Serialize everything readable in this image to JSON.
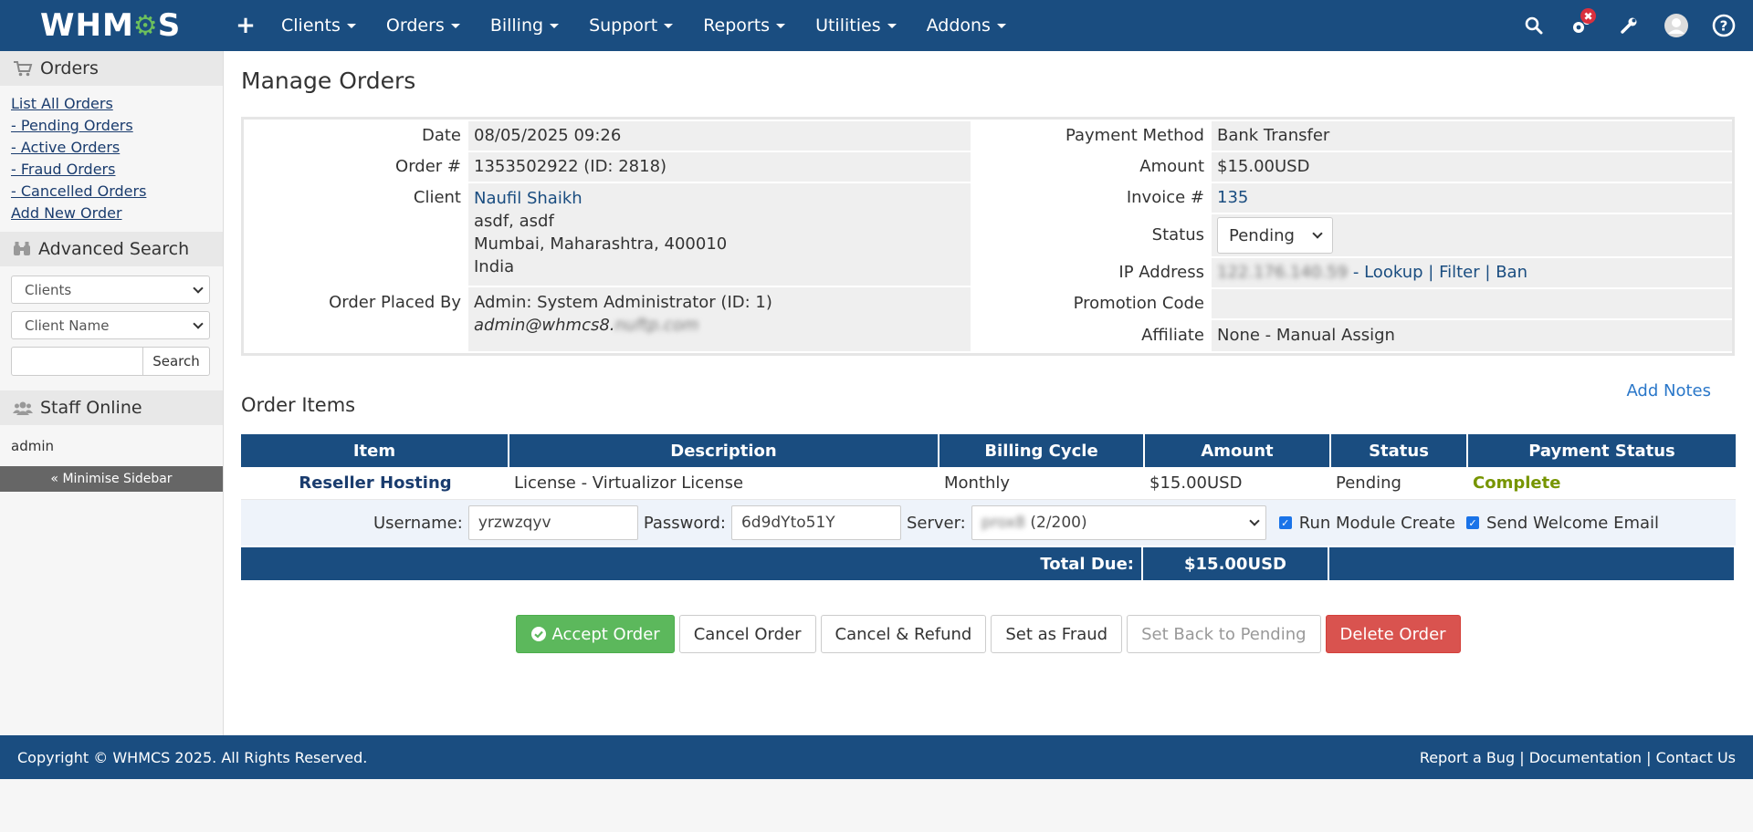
{
  "nav": {
    "logo_text_1": "WHM",
    "logo_text_2": "S",
    "items": [
      "Clients",
      "Orders",
      "Billing",
      "Support",
      "Reports",
      "Utilities",
      "Addons"
    ],
    "notification_badge": "✖"
  },
  "sidebar": {
    "orders_title": "Orders",
    "links": [
      "List All Orders",
      "- Pending Orders",
      "- Active Orders",
      "- Fraud Orders",
      "- Cancelled Orders",
      "Add New Order"
    ],
    "search_title": "Advanced Search",
    "search_type": "Clients",
    "search_field": "Client Name",
    "search_button": "Search",
    "staff_title": "Staff Online",
    "staff_name": "admin",
    "minimise": "« Minimise Sidebar"
  },
  "page": {
    "title": "Manage Orders"
  },
  "order": {
    "date_label": "Date",
    "date": "08/05/2025 09:26",
    "order_no_label": "Order #",
    "order_no": "1353502922 (ID: 2818)",
    "client_label": "Client",
    "client_name": "Naufil Shaikh",
    "client_line2": "asdf, asdf",
    "client_line3": "Mumbai, Maharashtra, 400010",
    "client_line4": "India",
    "placed_by_label": "Order Placed By",
    "placed_by": "Admin: System Administrator (ID: 1)",
    "placed_by_email": "admin@whmcs8.",
    "placed_by_email_blur": "nuftp.com",
    "payment_method_label": "Payment Method",
    "payment_method": "Bank Transfer",
    "amount_label": "Amount",
    "amount": "$15.00USD",
    "invoice_label": "Invoice #",
    "invoice": "135",
    "status_label": "Status",
    "status": "Pending",
    "ip_label": "IP Address",
    "ip_blur": "122.176.140.59",
    "ip_lookup": "Lookup",
    "ip_filter": "Filter",
    "ip_ban": "Ban",
    "promo_label": "Promotion Code",
    "promo": "",
    "affiliate_label": "Affiliate",
    "affiliate": "None - Manual Assign"
  },
  "items": {
    "title": "Order Items",
    "add_notes": "Add Notes",
    "headers": [
      "Item",
      "Description",
      "Billing Cycle",
      "Amount",
      "Status",
      "Payment Status"
    ],
    "row": {
      "item": "Reseller Hosting",
      "description": "License - Virtualizor License",
      "billing_cycle": "Monthly",
      "amount": "$15.00USD",
      "status": "Pending",
      "payment_status": "Complete"
    },
    "setup": {
      "username_label": "Username:",
      "username": "yrzwzqyv",
      "password_label": "Password:",
      "password": "6d9dYto51Y",
      "server_label": "Server:",
      "server_blur": "prox8",
      "server_count": "(2/200)",
      "run_module": "Run Module Create",
      "send_welcome": "Send Welcome Email"
    },
    "total_label": "Total Due:",
    "total": "$15.00USD"
  },
  "actions": {
    "accept": "Accept Order",
    "cancel": "Cancel Order",
    "cancel_refund": "Cancel & Refund",
    "fraud": "Set as Fraud",
    "pending": "Set Back to Pending",
    "delete": "Delete Order"
  },
  "footer": {
    "copyright": "Copyright © WHMCS 2025. All Rights Reserved.",
    "bug": "Report a Bug",
    "docs": "Documentation",
    "contact": "Contact Us"
  },
  "colors": {
    "brand": "#1a4d80",
    "success": "#5cb85c",
    "danger": "#d9534f",
    "complete_text": "#779500"
  }
}
